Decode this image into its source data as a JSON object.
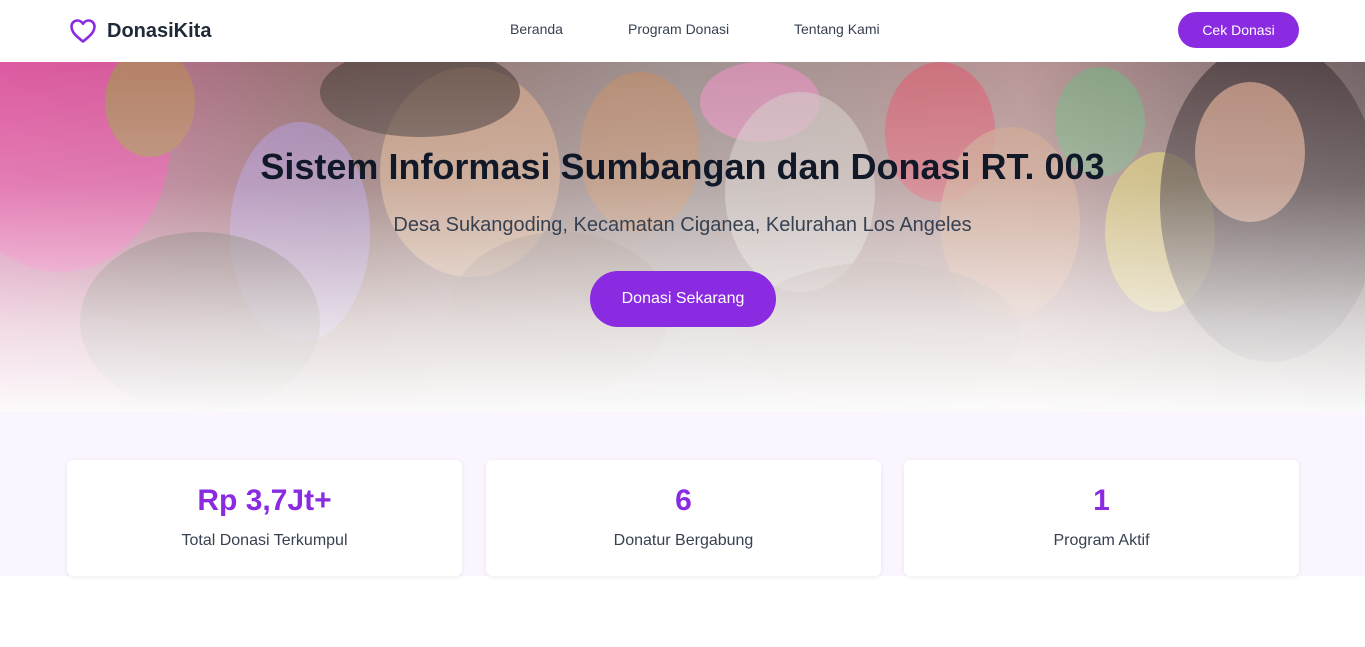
{
  "navbar": {
    "brand": "DonasiKita",
    "links": [
      "Beranda",
      "Program Donasi",
      "Tentang Kami"
    ],
    "cta": "Cek Donasi"
  },
  "hero": {
    "title": "Sistem Informasi Sumbangan dan Donasi RT. 003",
    "subtitle": "Desa Sukangoding, Kecamatan Ciganea, Kelurahan Los Angeles",
    "button": "Donasi Sekarang"
  },
  "stats": [
    {
      "value": "Rp 3,7Jt+",
      "label": "Total Donasi Terkumpul"
    },
    {
      "value": "6",
      "label": "Donatur Bergabung"
    },
    {
      "value": "1",
      "label": "Program Aktif"
    }
  ],
  "colors": {
    "accent": "#8a2be2",
    "stats_bg": "#faf5ff",
    "text_dark": "#111827"
  },
  "icons": {
    "brand": "heart-icon"
  }
}
